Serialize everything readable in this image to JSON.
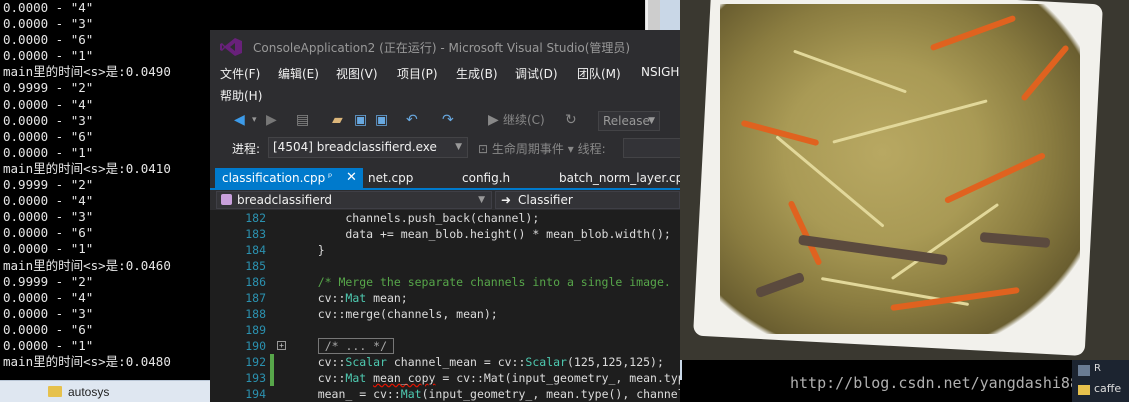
{
  "console": {
    "lines": [
      "0.0000 - \"4\"",
      "0.0000 - \"3\"",
      "0.0000 - \"6\"",
      "0.0000 - \"1\"",
      "main里的时间<s>是:0.0490",
      "0.9999 - \"2\"",
      "0.0000 - \"4\"",
      "0.0000 - \"3\"",
      "0.0000 - \"6\"",
      "0.0000 - \"1\"",
      "main里的时间<s>是:0.0410",
      "0.9999 - \"2\"",
      "0.0000 - \"4\"",
      "0.0000 - \"3\"",
      "0.0000 - \"6\"",
      "0.0000 - \"1\"",
      "main里的时间<s>是:0.0460",
      "0.9999 - \"2\"",
      "0.0000 - \"4\"",
      "0.0000 - \"3\"",
      "0.0000 - \"6\"",
      "0.0000 - \"1\"",
      "main里的时间<s>是:0.0480"
    ]
  },
  "taskbar": {
    "label": "autosys"
  },
  "vs": {
    "title": "ConsoleApplication2 (正在运行) - Microsoft Visual Studio(管理员)",
    "menu": [
      "文件(F)",
      "编辑(E)",
      "视图(V)",
      "项目(P)",
      "生成(B)",
      "调试(D)",
      "团队(M)",
      "NSIGH",
      "帮助(H)"
    ],
    "toolbar": {
      "continue_label": "继续(C)",
      "config": "Release"
    },
    "process": {
      "label": "进程:",
      "value": "[4504] breadclassifierd.exe",
      "lifecycle": "生命周期事件",
      "thread": "线程:"
    },
    "tabs": [
      {
        "label": "classification.cpp",
        "pin": "ᵖ",
        "close": "✕"
      },
      {
        "label": "net.cpp"
      },
      {
        "label": "config.h"
      },
      {
        "label": "batch_norm_layer.cp"
      }
    ],
    "nav": {
      "scope": "breadclassifierd",
      "member": "Classifier",
      "member_icon": "➜"
    },
    "code": [
      {
        "n": "182",
        "text": "        channels.push_back(channel);"
      },
      {
        "n": "183",
        "text": "        data += mean_blob.height() * mean_blob.width();"
      },
      {
        "n": "184",
        "text": "    }"
      },
      {
        "n": "185",
        "text": ""
      },
      {
        "n": "186",
        "text": "    /* Merge the separate channels into a single image."
      },
      {
        "n": "187",
        "pre": "    cv::",
        "type": "Mat",
        "post": " mean;"
      },
      {
        "n": "188",
        "text": "    cv::merge(channels, mean);"
      },
      {
        "n": "189",
        "text": ""
      },
      {
        "n": "190",
        "collapsed": "/* ... */"
      },
      {
        "n": "192",
        "pre": "    cv::",
        "type": "Scalar",
        "mid": " channel_mean = cv::",
        "type2": "Scalar",
        "post": "(125,125,125);"
      },
      {
        "n": "193",
        "pre": "    cv::",
        "type": "Mat",
        "mid": " ",
        "squig": "mean_copy",
        "post": " = cv::Mat(input_geometry_, mean.type(), channel_mean);"
      },
      {
        "n": "194",
        "pre": "    mean_ = cv::",
        "type": "Mat",
        "post": "(input_geometry_, mean.type(), channel_mean);"
      }
    ]
  },
  "watermark": "http://blog.csdn.net/yangdashi888",
  "tray": {
    "top": "R",
    "bottom": "caffe"
  }
}
